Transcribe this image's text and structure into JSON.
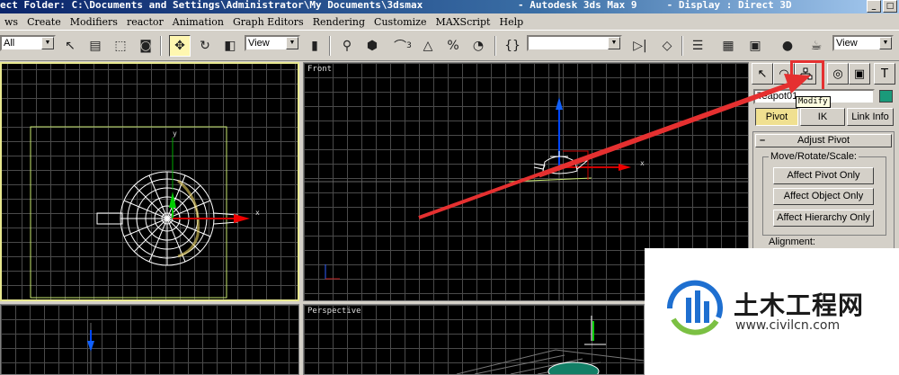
{
  "window": {
    "title_left": "ect Folder: C:\\Documents and Settings\\Administrator\\My Documents\\3dsmax",
    "title_center": "- Autodesk 3ds Max 9",
    "title_right": "- Display : Direct 3D"
  },
  "menu": {
    "items": [
      "ws",
      "Create",
      "Modifiers",
      "reactor",
      "Animation",
      "Graph Editors",
      "Rendering",
      "Customize",
      "MAXScript",
      "Help"
    ]
  },
  "toolbar": {
    "selection_filter": "All",
    "ref_coord_1": "View",
    "ref_coord_2": "View",
    "named_selection": "",
    "snap_label": "3"
  },
  "viewports": {
    "top_label": "",
    "front_label": "Front",
    "left_label": "",
    "persp_label": "Perspective",
    "axis_y": "y",
    "axis_x": "x"
  },
  "command_panel": {
    "tooltip": "Modify",
    "object_name": "Teapot01",
    "subtabs": [
      "Pivot",
      "IK",
      "Link Info"
    ],
    "rollout_title": "Adjust Pivot",
    "group_move": "Move/Rotate/Scale:",
    "buttons": [
      "Affect Pivot Only",
      "Affect Object Only",
      "Affect Hierarchy Only"
    ],
    "group_align": "Alignment:"
  },
  "watermark": {
    "brand": "土木工程网",
    "url": "www.civilcn.com"
  },
  "colors": {
    "highlight": "#e53030",
    "object_color": "#1a9a7a"
  }
}
